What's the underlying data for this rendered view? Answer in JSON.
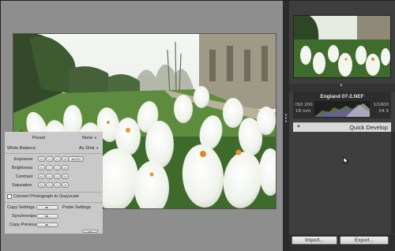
{
  "preview": {
    "file_name": "England 07-2.NEF",
    "exif": {
      "iso": "ISO 200",
      "focal": "18 mm",
      "shutter": "1/1600",
      "aperture": "f/4.5"
    }
  },
  "quick_develop": {
    "title": "Quick Develop",
    "preset": {
      "label": "Preset",
      "value": "None"
    },
    "white_balance": {
      "label": "White Balance",
      "value": "As Shot"
    },
    "exposure": {
      "label": "Exposure",
      "auto_label": "AUTO"
    },
    "brightness": {
      "label": "Brightness"
    },
    "contrast": {
      "label": "Contrast"
    },
    "saturation": {
      "label": "Saturation"
    },
    "stepper_glyphs": {
      "big_down": "«",
      "down": "‹",
      "up": "›",
      "big_up": "»"
    },
    "grayscale_label": "Convert Photograph to Grayscale",
    "copy_settings": "Copy Settings",
    "paste_settings": "Paste Settings",
    "synchronize": "Synchronize",
    "copy_previous": "Copy Previous"
  },
  "buttons": {
    "import": "Import...",
    "export": "Export..."
  },
  "icons": {
    "collapse": "panel-collapse-icon",
    "disclosure": "disclosure-triangle-icon",
    "cursor": "mouse-pointer-icon"
  },
  "colors": {
    "panel_bg": "#3e3e3e",
    "quick_develop_bg": "#c9c9c9",
    "viewer_bg": "#8e8e8e"
  }
}
